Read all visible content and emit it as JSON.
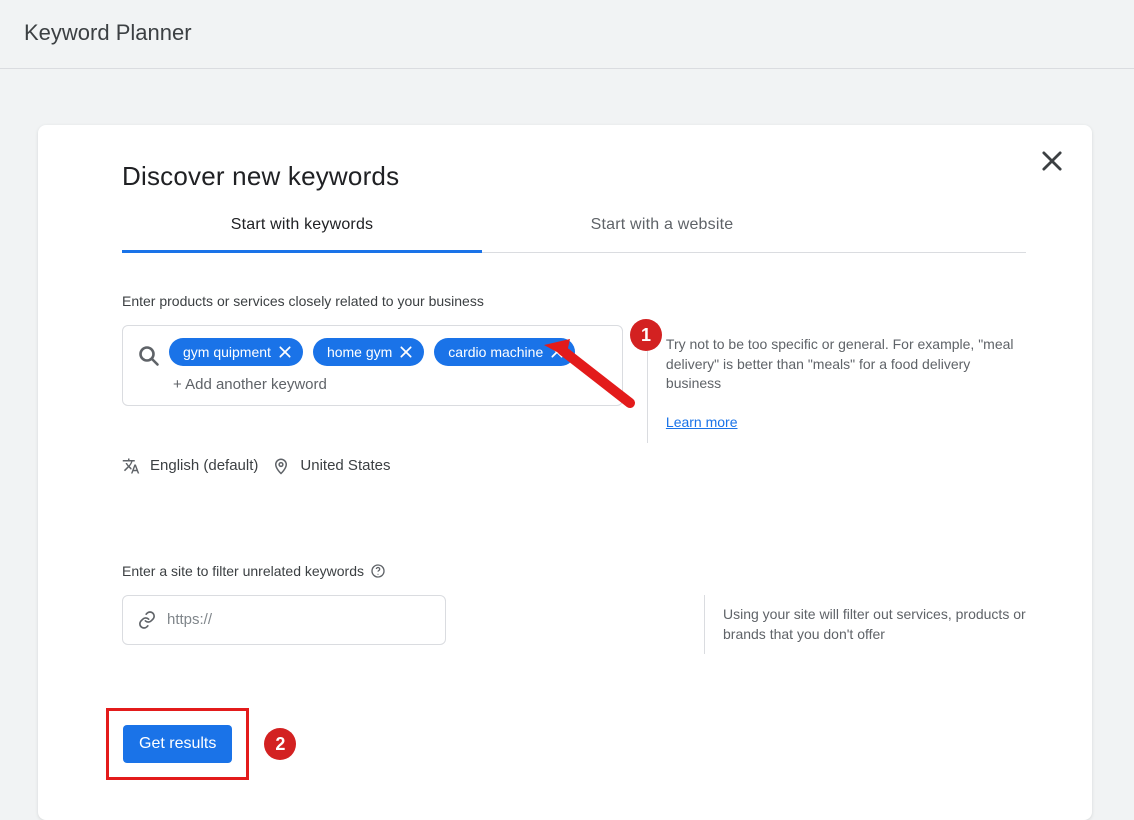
{
  "header": {
    "title": "Keyword Planner"
  },
  "card": {
    "title": "Discover new keywords",
    "tabs": {
      "keywords": "Start with keywords",
      "website": "Start with a website"
    },
    "keyword_section": {
      "label": "Enter products or services closely related to your business",
      "chips": {
        "0": "gym quipment",
        "1": "home gym",
        "2": "cardio machine"
      },
      "add_placeholder": "+ Add another keyword",
      "tip": "Try not to be too specific or general. For example, \"meal delivery\" is better than \"meals\" for a food delivery business",
      "learn_more": "Learn more"
    },
    "meta": {
      "language": "English (default)",
      "location": "United States"
    },
    "site_section": {
      "label": "Enter a site to filter unrelated keywords",
      "placeholder": "https://",
      "tip": "Using your site will filter out services, products or brands that you don't offer"
    },
    "cta_label": "Get results"
  },
  "annotations": {
    "badge1": "1",
    "badge2": "2"
  }
}
